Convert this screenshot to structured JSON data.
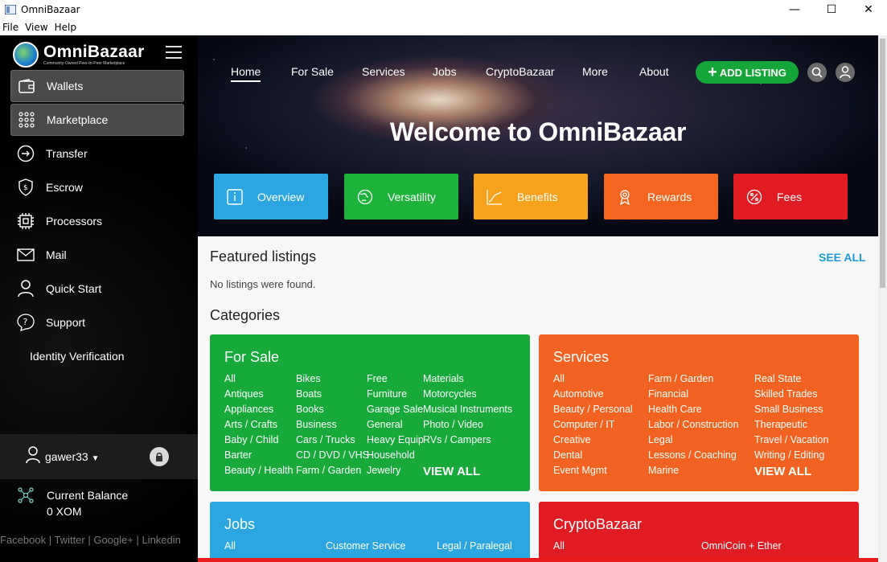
{
  "window": {
    "title": "OmniBazaar",
    "minimize": "—",
    "maximize": "☐",
    "close": "✕"
  },
  "menu": [
    "File",
    "View",
    "Help"
  ],
  "sidebar": {
    "logo_name": "OmniBazaar",
    "logo_tagline": "Community-Owned Peer-to-Peer Marketplace",
    "items": [
      {
        "label": "Wallets",
        "icon": "wallet-icon",
        "active": true
      },
      {
        "label": "Marketplace",
        "icon": "grid-icon",
        "active": true
      },
      {
        "label": "Transfer",
        "icon": "arrow-circle-icon",
        "active": false
      },
      {
        "label": "Escrow",
        "icon": "shield-icon",
        "active": false
      },
      {
        "label": "Processors",
        "icon": "chip-icon",
        "active": false
      },
      {
        "label": "Mail",
        "icon": "mail-icon",
        "active": false
      },
      {
        "label": "Quick Start",
        "icon": "user-icon",
        "active": false
      },
      {
        "label": "Support",
        "icon": "help-icon",
        "active": false
      },
      {
        "label": "Identity Verification",
        "icon": "",
        "active": false
      }
    ],
    "username": "gawer33",
    "balance_label": "Current Balance",
    "balance_value": "0 XOM",
    "social": "Facebook | Twitter | Google+ | Linkedin"
  },
  "topnav": {
    "links": [
      "Home",
      "For Sale",
      "Services",
      "Jobs",
      "CryptoBazaar",
      "More",
      "About"
    ],
    "add_listing": "ADD LISTING"
  },
  "hero": {
    "welcome": "Welcome to OmniBazaar"
  },
  "tiles": [
    {
      "label": "Overview",
      "color": "#2ba6e0",
      "icon": "info-icon"
    },
    {
      "label": "Versatility",
      "color": "#1db33a",
      "icon": "globe-icon"
    },
    {
      "label": "Benefits",
      "color": "#f7a21c",
      "icon": "chart-icon"
    },
    {
      "label": "Rewards",
      "color": "#f4661f",
      "icon": "award-icon"
    },
    {
      "label": "Fees",
      "color": "#e11b22",
      "icon": "percent-icon"
    }
  ],
  "featured": {
    "title": "Featured listings",
    "see_all": "SEE ALL",
    "empty": "No listings were found."
  },
  "categories_title": "Categories",
  "categories": {
    "for_sale": {
      "title": "For Sale",
      "color": "#17a93a",
      "cols": [
        [
          "All",
          "Antiques",
          "Appliances",
          "Arts / Crafts",
          "Baby / Child",
          "Barter",
          "Beauty / Health"
        ],
        [
          "Bikes",
          "Boats",
          "Books",
          "Business",
          "Cars / Trucks",
          "CD / DVD / VHS",
          "Farm / Garden"
        ],
        [
          "Free",
          "Furniture",
          "Garage Sale",
          "General",
          "Heavy Equip",
          "Household",
          "Jewelry"
        ],
        [
          "Materials",
          "Motorcycles",
          "Musical Instruments",
          "Photo / Video",
          "RVs / Campers"
        ]
      ],
      "view_all": "VIEW ALL"
    },
    "services": {
      "title": "Services",
      "color": "#f26322",
      "cols": [
        [
          "All",
          "Automotive",
          "Beauty / Personal",
          "Computer / IT",
          "Creative",
          "Dental",
          "Event Mgmt"
        ],
        [
          "Farm / Garden",
          "Financial",
          "Health Care",
          "Labor / Construction",
          "Legal",
          "Lessons / Coaching",
          "Marine"
        ],
        [
          "Real State",
          "Skilled Trades",
          "Small Business",
          "Therapeutic",
          "Travel / Vacation",
          "Writing / Editing"
        ]
      ],
      "view_all": "VIEW ALL"
    },
    "jobs": {
      "title": "Jobs",
      "color": "#2ba6e0",
      "cols": [
        [
          "All"
        ],
        [
          "Customer Service"
        ],
        [
          "Legal / Paralegal"
        ]
      ]
    },
    "crypto": {
      "title": "CryptoBazaar",
      "color": "#e11b22",
      "cols": [
        [
          "All"
        ],
        [
          "OmniCoin + Ether"
        ]
      ]
    }
  }
}
